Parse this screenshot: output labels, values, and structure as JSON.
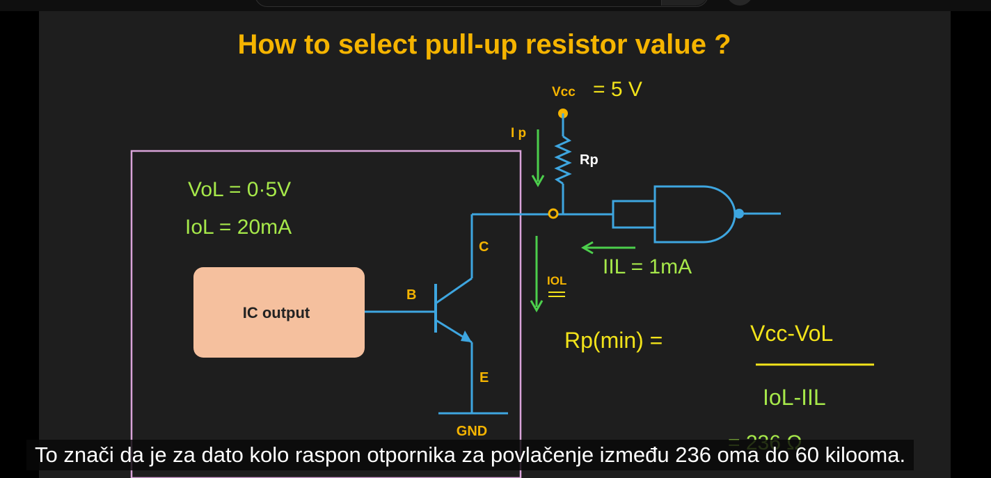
{
  "slide": {
    "title": "How to select pull-up resistor value ?",
    "vcc_label": "Vcc",
    "vcc_value": "= 5 V",
    "ip_label": "I p",
    "rp_label": "Rp",
    "vol_note": "VoL = 0·5V",
    "iol_note": "IoL = 20mA",
    "ic_box_label": "IC output",
    "c_label": "C",
    "b_label": "B",
    "e_label": "E",
    "gnd_label": "GND",
    "iol_label": "IOL",
    "iil_note": "IIL = 1mA",
    "rp_min_lhs": "Rp(min) =",
    "numerator": "Vcc-VoL",
    "denominator": "IoL-IIL",
    "partial_result": "= 236 Ω"
  },
  "caption": {
    "text": "To znači da je za dato kolo raspon otpornika za povlačenje između 236 oma do 60 kilooma."
  },
  "colors": {
    "title": "#f5b400",
    "labels": "#f5b400",
    "handwriting_green": "#a6e84a",
    "handwriting_yellow": "#f2e31a",
    "wire": "#3ea6e0",
    "box_border": "#d9a3d9",
    "ic_fill": "#f5c09e",
    "green_arrow": "#4ccf4c"
  }
}
